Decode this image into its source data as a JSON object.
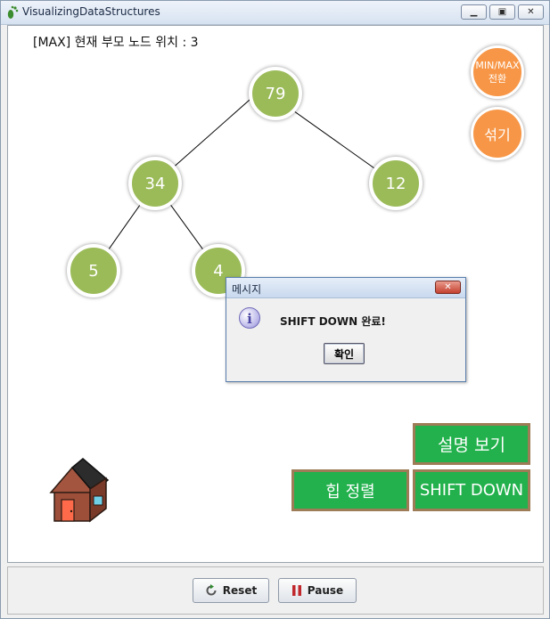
{
  "window": {
    "title": "VisualizingDataStructures"
  },
  "status_text": "[MAX] 현재 부모 노드 위치 : 3",
  "tree": {
    "nodes": [
      "79",
      "34",
      "12",
      "5",
      "4"
    ]
  },
  "side_buttons": {
    "toggle_line1": "MIN/MAX",
    "toggle_line2": "전환",
    "shuffle": "섞기"
  },
  "action_buttons": {
    "explain": "설명 보기",
    "heap_sort": "힙 정렬",
    "shift_down": "SHIFT DOWN"
  },
  "dialog": {
    "title": "메시지",
    "message": "SHIFT DOWN 완료!",
    "ok_label": "확인",
    "close_glyph": "✕"
  },
  "controls": {
    "reset_label": "Reset",
    "pause_label": "Pause"
  },
  "colors": {
    "node": "#9bbb59",
    "orange": "#f79646",
    "green": "#22b14c"
  }
}
